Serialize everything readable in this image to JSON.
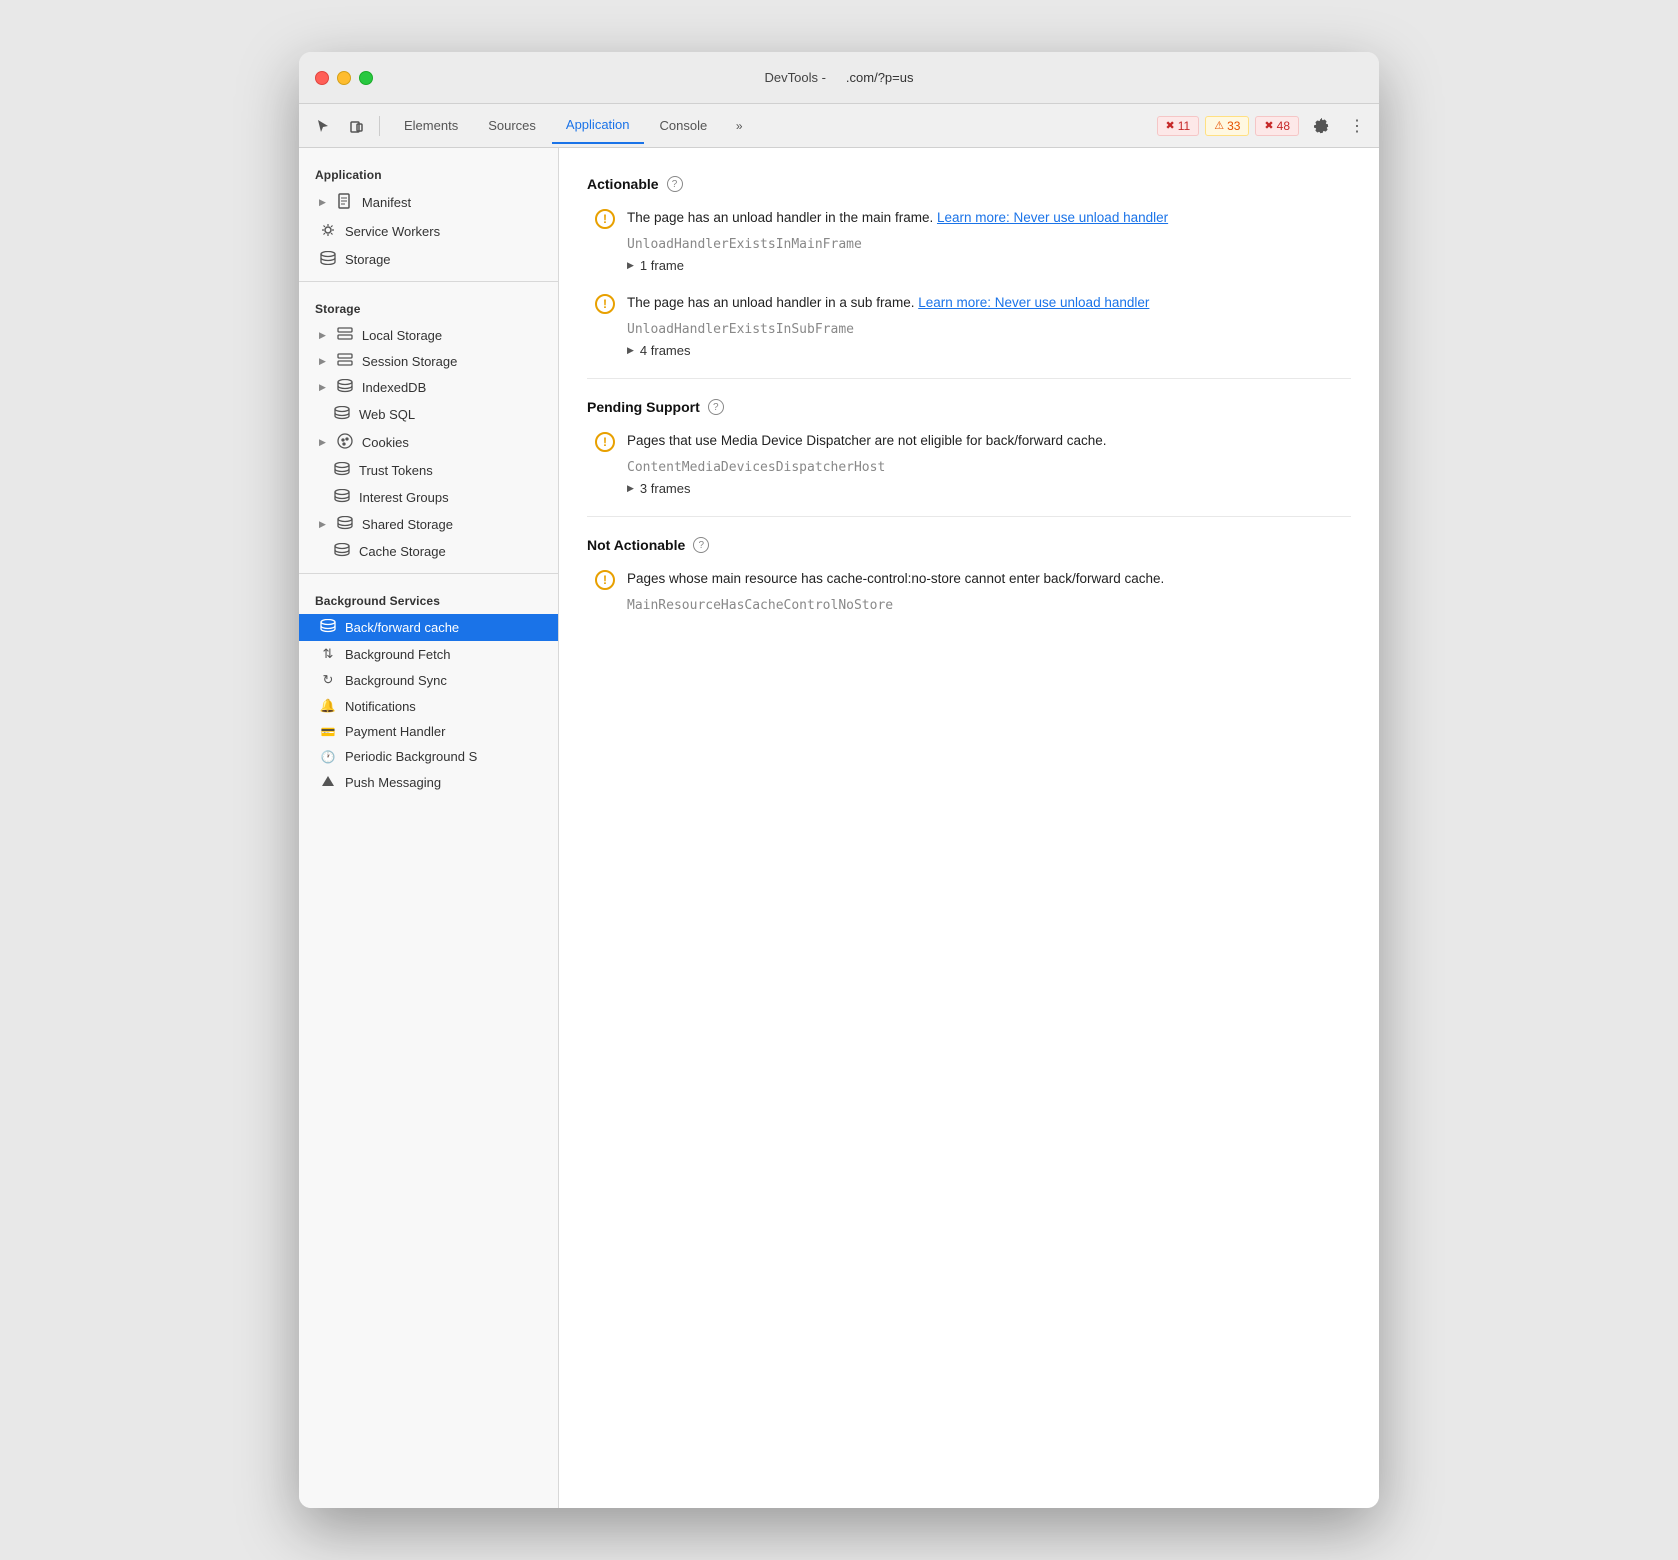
{
  "titleBar": {
    "devtools": "DevTools -",
    "url": ".com/?p=us"
  },
  "toolbar": {
    "tabs": [
      {
        "id": "elements",
        "label": "Elements",
        "active": false
      },
      {
        "id": "sources",
        "label": "Sources",
        "active": false
      },
      {
        "id": "application",
        "label": "Application",
        "active": true
      },
      {
        "id": "console",
        "label": "Console",
        "active": false
      }
    ],
    "badges": {
      "errors": {
        "icon": "✖",
        "count": "11"
      },
      "warnings": {
        "icon": "⚠",
        "count": "33"
      },
      "issues": {
        "icon": "✖",
        "count": "48"
      }
    }
  },
  "sidebar": {
    "applicationSection": {
      "label": "Application",
      "items": [
        {
          "id": "manifest",
          "icon": "📄",
          "label": "Manifest",
          "hasArrow": true
        },
        {
          "id": "service-workers",
          "icon": "⚙",
          "label": "Service Workers",
          "hasArrow": false
        },
        {
          "id": "storage",
          "icon": "🗄",
          "label": "Storage",
          "hasArrow": false
        }
      ]
    },
    "storageSection": {
      "label": "Storage",
      "items": [
        {
          "id": "local-storage",
          "icon": "▦",
          "label": "Local Storage",
          "hasArrow": true
        },
        {
          "id": "session-storage",
          "icon": "▦",
          "label": "Session Storage",
          "hasArrow": true
        },
        {
          "id": "indexeddb",
          "icon": "🗄",
          "label": "IndexedDB",
          "hasArrow": true
        },
        {
          "id": "web-sql",
          "icon": "🗄",
          "label": "Web SQL",
          "hasArrow": false
        },
        {
          "id": "cookies",
          "icon": "🍪",
          "label": "Cookies",
          "hasArrow": true
        },
        {
          "id": "trust-tokens",
          "icon": "🗄",
          "label": "Trust Tokens",
          "hasArrow": false
        },
        {
          "id": "interest-groups",
          "icon": "🗄",
          "label": "Interest Groups",
          "hasArrow": false
        },
        {
          "id": "shared-storage",
          "icon": "🗄",
          "label": "Shared Storage",
          "hasArrow": true
        },
        {
          "id": "cache-storage",
          "icon": "🗄",
          "label": "Cache Storage",
          "hasArrow": false
        }
      ]
    },
    "backgroundSection": {
      "label": "Background Services",
      "items": [
        {
          "id": "back-forward-cache",
          "icon": "🗄",
          "label": "Back/forward cache",
          "hasArrow": false,
          "active": true
        },
        {
          "id": "background-fetch",
          "icon": "↑↓",
          "label": "Background Fetch",
          "hasArrow": false
        },
        {
          "id": "background-sync",
          "icon": "↻",
          "label": "Background Sync",
          "hasArrow": false
        },
        {
          "id": "notifications",
          "icon": "🔔",
          "label": "Notifications",
          "hasArrow": false
        },
        {
          "id": "payment-handler",
          "icon": "💳",
          "label": "Payment Handler",
          "hasArrow": false
        },
        {
          "id": "periodic-background",
          "icon": "🕐",
          "label": "Periodic Background S",
          "hasArrow": false
        },
        {
          "id": "push-messaging",
          "icon": "▲",
          "label": "Push Messaging",
          "hasArrow": false
        }
      ]
    }
  },
  "content": {
    "sections": [
      {
        "id": "actionable",
        "title": "Actionable",
        "issues": [
          {
            "id": "unload-main",
            "text": "The page has an unload handler in the main frame.",
            "linkText": "Learn more: Never use unload handler",
            "code": "UnloadHandlerExistsInMainFrame",
            "frames": "1 frame"
          },
          {
            "id": "unload-sub",
            "text": "The page has an unload handler in a sub frame.",
            "linkText": "Learn more: Never use unload handler",
            "code": "UnloadHandlerExistsInSubFrame",
            "frames": "4 frames"
          }
        ]
      },
      {
        "id": "pending-support",
        "title": "Pending Support",
        "issues": [
          {
            "id": "media-device",
            "text": "Pages that use Media Device Dispatcher are not eligible for back/forward cache.",
            "linkText": null,
            "code": "ContentMediaDevicesDispatcherHost",
            "frames": "3 frames"
          }
        ]
      },
      {
        "id": "not-actionable",
        "title": "Not Actionable",
        "issues": [
          {
            "id": "cache-control",
            "text": "Pages whose main resource has cache-control:no-store cannot enter back/forward cache.",
            "linkText": null,
            "code": "MainResourceHasCacheControlNoStore",
            "frames": null
          }
        ]
      }
    ]
  }
}
